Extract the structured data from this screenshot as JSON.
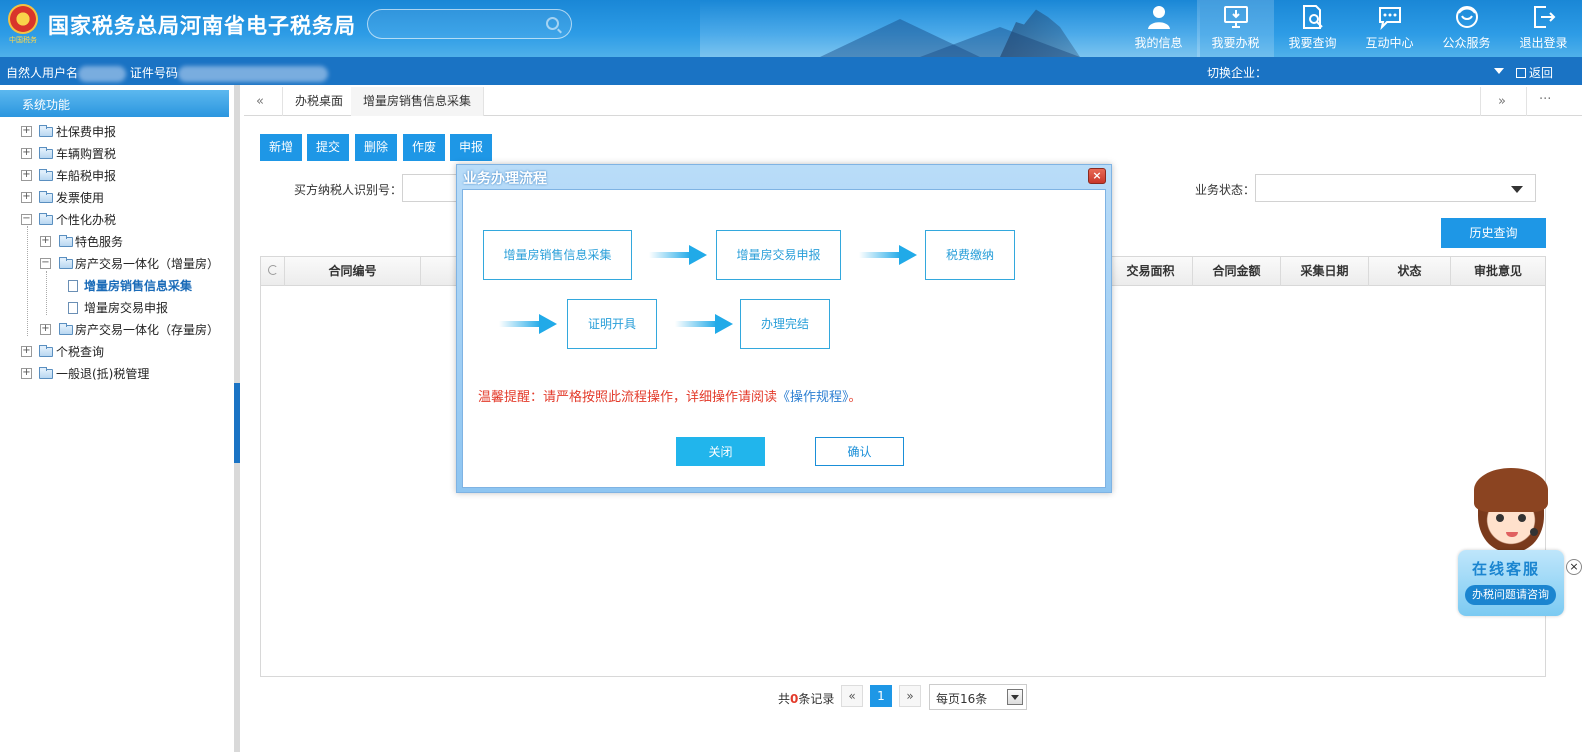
{
  "header": {
    "emblem_caption": "中国税务",
    "title": "国家税务总局河南省电子税务局",
    "search_placeholder": "",
    "nav": [
      {
        "label": "我的信息",
        "icon": "user-icon"
      },
      {
        "label": "我要办税",
        "icon": "monitor-icon",
        "active": true
      },
      {
        "label": "我要查询",
        "icon": "document-search-icon"
      },
      {
        "label": "互动中心",
        "icon": "chat-icon"
      },
      {
        "label": "公众服务",
        "icon": "service-icon"
      },
      {
        "label": "退出登录",
        "icon": "logout-icon"
      }
    ]
  },
  "subbar": {
    "user_label": "自然人用户名",
    "id_label": "证件号码",
    "switch_label": "切换企业：",
    "back_label": "返回"
  },
  "sidebar": {
    "title": "系统功能",
    "items": [
      {
        "label": "社保费申报"
      },
      {
        "label": "车辆购置税"
      },
      {
        "label": "车船税申报"
      },
      {
        "label": "发票使用"
      },
      {
        "label": "个性化办税"
      },
      {
        "label": "特色服务"
      },
      {
        "label": "房产交易一体化（增量房）"
      },
      {
        "label": "增量房销售信息采集"
      },
      {
        "label": "增量房交易申报"
      },
      {
        "label": "房产交易一体化（存量房）"
      },
      {
        "label": "个税查询"
      },
      {
        "label": "一般退(抵)税管理"
      }
    ]
  },
  "tabs": {
    "left_arrow": "«",
    "right_arrow": "»",
    "more": "···",
    "items": [
      {
        "label": "办税桌面"
      },
      {
        "label": "增量房销售信息采集"
      }
    ]
  },
  "toolbar": {
    "buttons": [
      "新增",
      "提交",
      "删除",
      "作废",
      "申报"
    ]
  },
  "filters": {
    "buyer_label": "买方纳税人识别号：",
    "status_label": "业务状态：",
    "history_button": "历史查询"
  },
  "grid": {
    "columns": [
      "合同编号",
      "交易面积",
      "合同金额",
      "采集日期",
      "状态",
      "审批意见"
    ]
  },
  "pager": {
    "total_prefix": "共",
    "total_count": "0",
    "total_suffix": "条记录",
    "prev": "«",
    "current_page": "1",
    "next": "»",
    "page_size": "每页16条"
  },
  "modal": {
    "title": "业务办理流程",
    "close_glyph": "×",
    "steps": [
      "增量房销售信息采集",
      "增量房交易申报",
      "税费缴纳",
      "证明开具",
      "办理完结"
    ],
    "warning_prefix": "温馨提醒：请严格按照此流程操作，详细操作请阅读",
    "warning_link": "《操作规程》",
    "warning_suffix": "。",
    "close_button": "关闭",
    "confirm_button": "确认"
  },
  "assistant": {
    "title": "在线客服",
    "subtitle": "办税问题请咨询",
    "close_glyph": "×"
  },
  "colors": {
    "primary": "#1e97e6",
    "header": "#1a87d6",
    "subbar": "#1a73c4",
    "warning": "#e33b2b"
  }
}
